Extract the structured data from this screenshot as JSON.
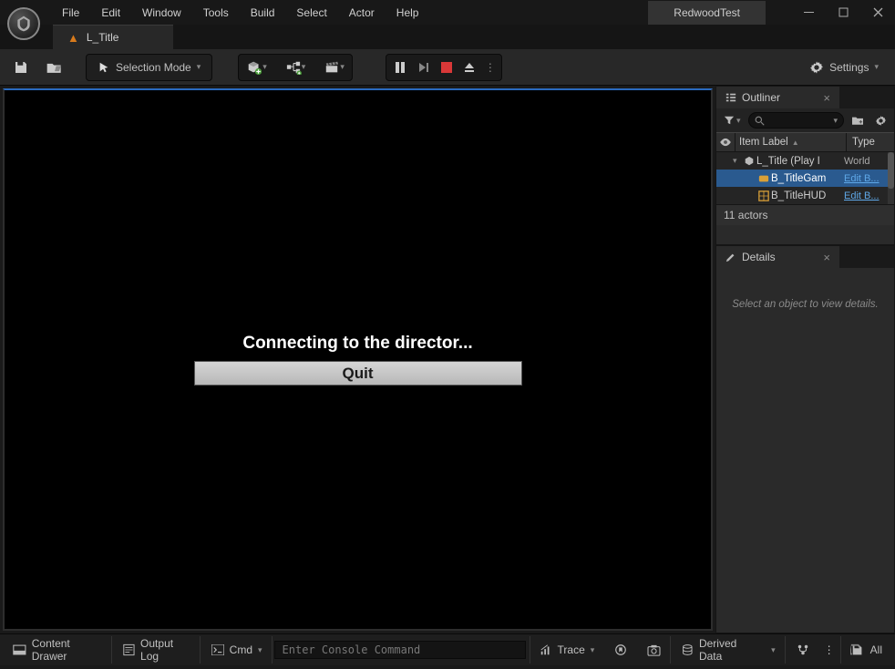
{
  "menu": {
    "file": "File",
    "edit": "Edit",
    "window": "Window",
    "tools": "Tools",
    "build": "Build",
    "select": "Select",
    "actor": "Actor",
    "help": "Help"
  },
  "project_name": "RedwoodTest",
  "tab": {
    "label": "L_Title"
  },
  "toolbar": {
    "selection_mode": "Selection Mode",
    "settings": "Settings"
  },
  "viewport": {
    "connecting": "Connecting to the director...",
    "quit": "Quit"
  },
  "outliner": {
    "title": "Outliner",
    "col_label": "Item Label",
    "col_type": "Type",
    "rows": [
      {
        "label": "L_Title (Play I",
        "type": "World",
        "link": false
      },
      {
        "label": "B_TitleGam",
        "type": "Edit B...",
        "link": true
      },
      {
        "label": "B_TitleHUD",
        "type": "Edit B...",
        "link": true
      }
    ],
    "footer": "11 actors"
  },
  "details": {
    "title": "Details",
    "placeholder": "Select an object to view details."
  },
  "statusbar": {
    "content_drawer": "Content Drawer",
    "output_log": "Output Log",
    "cmd": "Cmd",
    "console_placeholder": "Enter Console Command",
    "trace": "Trace",
    "derived_data": "Derived Data",
    "all": "All"
  }
}
